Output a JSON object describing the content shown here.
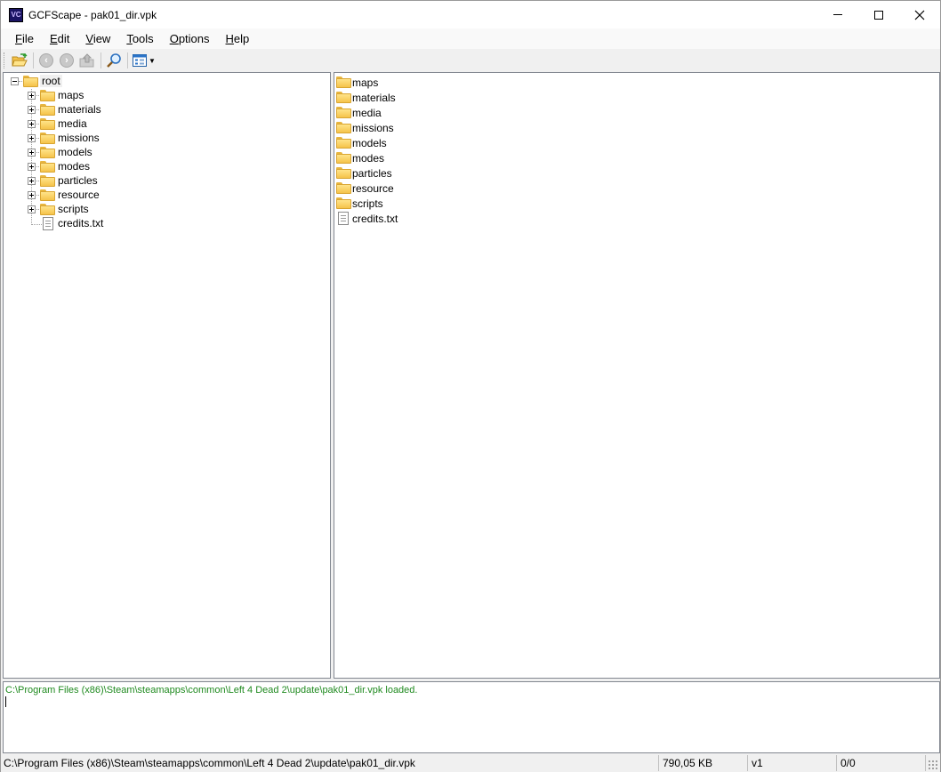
{
  "window": {
    "title": "GCFScape - pak01_dir.vpk",
    "app_icon": "gcfscape-icon",
    "controls": {
      "minimize": "minimize-icon",
      "maximize": "maximize-icon",
      "close": "close-icon"
    }
  },
  "menubar": {
    "items": [
      {
        "label": "File",
        "accel": "F",
        "rest": "ile"
      },
      {
        "label": "Edit",
        "accel": "E",
        "rest": "dit"
      },
      {
        "label": "View",
        "accel": "V",
        "rest": "iew"
      },
      {
        "label": "Tools",
        "accel": "T",
        "rest": "ools"
      },
      {
        "label": "Options",
        "accel": "O",
        "rest": "ptions"
      },
      {
        "label": "Help",
        "accel": "H",
        "rest": "elp"
      }
    ]
  },
  "toolbar": {
    "buttons": [
      "open-folder-icon",
      "back-icon",
      "forward-icon",
      "up-icon",
      "find-icon",
      "view-mode-icon"
    ]
  },
  "tree": {
    "root": "root",
    "items": [
      {
        "label": "maps",
        "type": "folder"
      },
      {
        "label": "materials",
        "type": "folder"
      },
      {
        "label": "media",
        "type": "folder"
      },
      {
        "label": "missions",
        "type": "folder"
      },
      {
        "label": "models",
        "type": "folder"
      },
      {
        "label": "modes",
        "type": "folder"
      },
      {
        "label": "particles",
        "type": "folder"
      },
      {
        "label": "resource",
        "type": "folder"
      },
      {
        "label": "scripts",
        "type": "folder"
      },
      {
        "label": "credits.txt",
        "type": "file"
      }
    ]
  },
  "list": {
    "items": [
      {
        "label": "maps",
        "type": "folder"
      },
      {
        "label": "materials",
        "type": "folder"
      },
      {
        "label": "media",
        "type": "folder"
      },
      {
        "label": "missions",
        "type": "folder"
      },
      {
        "label": "models",
        "type": "folder"
      },
      {
        "label": "modes",
        "type": "folder"
      },
      {
        "label": "particles",
        "type": "folder"
      },
      {
        "label": "resource",
        "type": "folder"
      },
      {
        "label": "scripts",
        "type": "folder"
      },
      {
        "label": "credits.txt",
        "type": "file"
      }
    ]
  },
  "log": {
    "message": "C:\\Program Files (x86)\\Steam\\steamapps\\common\\Left 4 Dead 2\\update\\pak01_dir.vpk loaded.",
    "color": "#1f8a1f"
  },
  "statusbar": {
    "path": "C:\\Program Files (x86)\\Steam\\steamapps\\common\\Left 4 Dead 2\\update\\pak01_dir.vpk",
    "size": "790,05 KB",
    "version": "v1",
    "count": "0/0"
  }
}
